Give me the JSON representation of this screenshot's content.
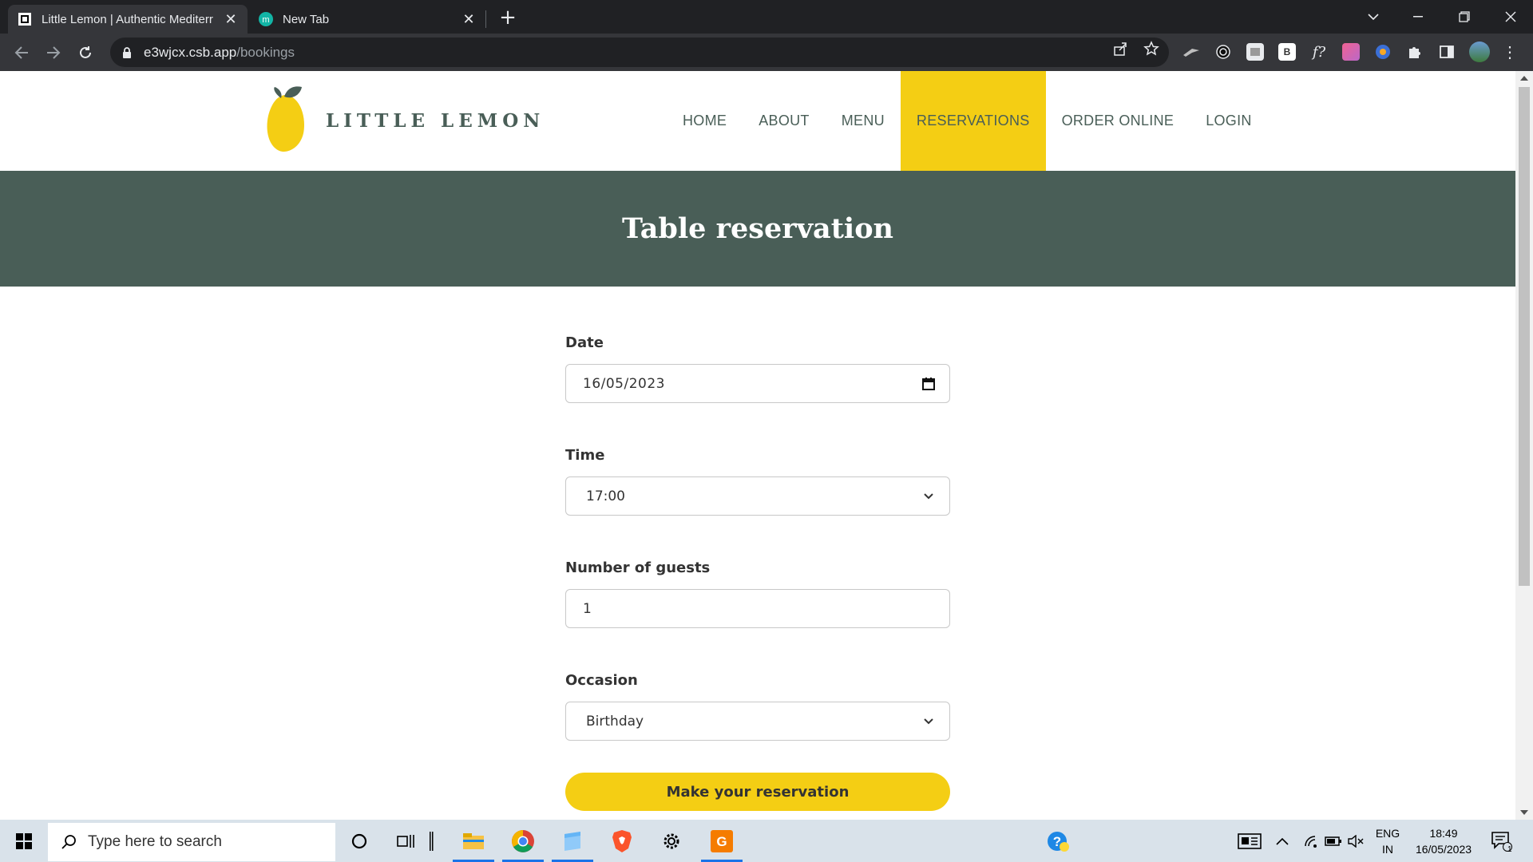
{
  "browser": {
    "tabs": [
      {
        "title": "Little Lemon | Authentic Mediterr",
        "active": true
      },
      {
        "title": "New Tab",
        "active": false
      }
    ],
    "url_host": "e3wjcx.csb.app",
    "url_path": "/bookings"
  },
  "site": {
    "brand": "LITTLE LEMON",
    "nav": [
      "HOME",
      "ABOUT",
      "MENU",
      "RESERVATIONS",
      "ORDER ONLINE",
      "LOGIN"
    ],
    "active_nav": "RESERVATIONS",
    "colors": {
      "primary": "#495e57",
      "accent": "#f4ce14"
    }
  },
  "hero": {
    "title": "Table reservation"
  },
  "form": {
    "date_label": "Date",
    "date_value": "16/05/2023",
    "time_label": "Time",
    "time_value": "17:00",
    "guests_label": "Number of guests",
    "guests_value": "1",
    "occasion_label": "Occasion",
    "occasion_value": "Birthday",
    "submit_label": "Make your reservation"
  },
  "taskbar": {
    "search_placeholder": "Type here to search",
    "lang_top": "ENG",
    "lang_bottom": "IN",
    "time": "18:49",
    "date": "16/05/2023",
    "notification_count": "1"
  }
}
